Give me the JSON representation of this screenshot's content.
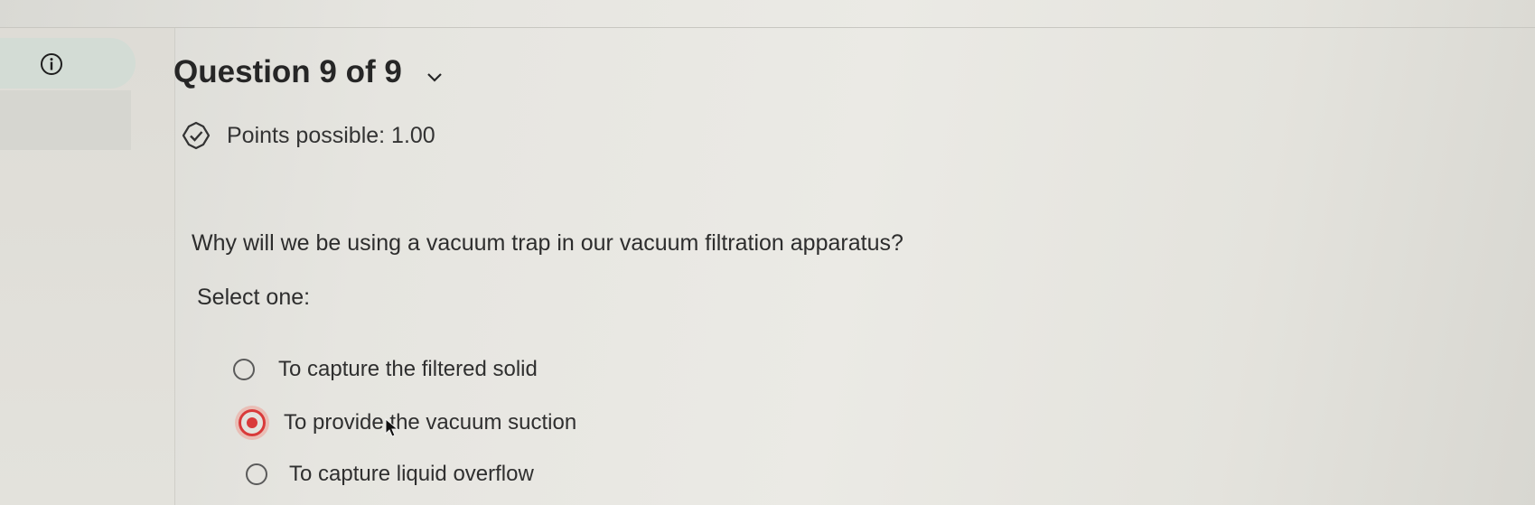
{
  "question": {
    "title": "Question 9 of 9",
    "points_label": "Points possible: 1.00",
    "prompt": "Why will we be using a vacuum trap in our vacuum filtration apparatus?",
    "instruction": "Select one:",
    "options": [
      {
        "label": "To capture the filtered solid",
        "selected": false
      },
      {
        "label": "To provide the vacuum suction",
        "selected": true
      },
      {
        "label": "To capture liquid overflow",
        "selected": false
      }
    ]
  },
  "colors": {
    "selected_radio": "#d93a3a",
    "info_tab": "#d3dcd5"
  },
  "icons": [
    "info-icon",
    "chevron-down-icon",
    "check-badge-icon",
    "mouse-cursor-icon"
  ]
}
